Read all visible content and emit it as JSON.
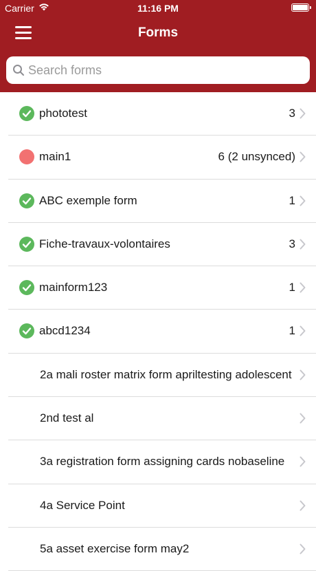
{
  "status_bar": {
    "carrier": "Carrier",
    "time": "11:16 PM",
    "battery_level": 1.0
  },
  "nav": {
    "title": "Forms",
    "menu_icon": "hamburger-menu-icon"
  },
  "search": {
    "placeholder": "Search forms",
    "value": ""
  },
  "colors": {
    "brand": "#a01d22",
    "synced": "#5cb85c",
    "unsynced": "#f27171"
  },
  "forms": [
    {
      "name": "phototest",
      "count": "3",
      "status": "synced"
    },
    {
      "name": "main1",
      "count": "6 (2 unsynced)",
      "status": "unsynced"
    },
    {
      "name": "ABC exemple form",
      "count": "1",
      "status": "synced"
    },
    {
      "name": "Fiche-travaux-volontaires",
      "count": "3",
      "status": "synced"
    },
    {
      "name": "mainform123",
      "count": "1",
      "status": "synced"
    },
    {
      "name": "abcd1234",
      "count": "1",
      "status": "synced"
    },
    {
      "name": "2a mali roster matrix form apriltesting adolescent",
      "count": "",
      "status": "none"
    },
    {
      "name": "2nd test al",
      "count": "",
      "status": "none"
    },
    {
      "name": "3a registration form assigning cards nobaseline",
      "count": "",
      "status": "none"
    },
    {
      "name": "4a Service Point",
      "count": "",
      "status": "none"
    },
    {
      "name": "5a asset exercise form may2",
      "count": "",
      "status": "none"
    }
  ]
}
